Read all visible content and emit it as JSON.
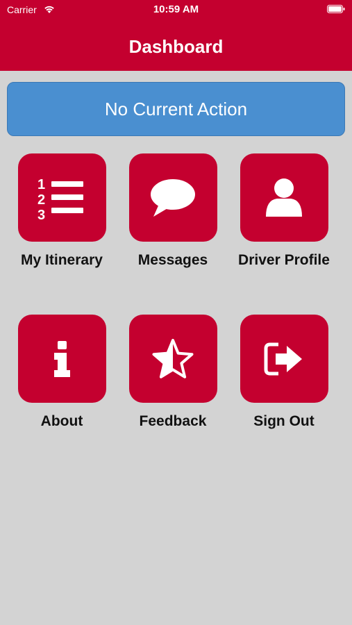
{
  "status_bar": {
    "carrier": "Carrier",
    "time": "10:59 AM",
    "wifi_icon": "wifi-icon",
    "battery_icon": "battery-icon"
  },
  "header": {
    "title": "Dashboard",
    "color": "#c4002f"
  },
  "action_banner": {
    "text": "No Current Action",
    "color": "#4a8fd0"
  },
  "tiles": [
    {
      "label": "My Itinerary",
      "icon": "numbered-list-icon"
    },
    {
      "label": "Messages",
      "icon": "speech-bubble-icon"
    },
    {
      "label": "Driver Profile",
      "icon": "user-icon"
    },
    {
      "label": "About",
      "icon": "info-icon"
    },
    {
      "label": "Feedback",
      "icon": "half-star-icon"
    },
    {
      "label": "Sign Out",
      "icon": "sign-out-icon"
    }
  ]
}
